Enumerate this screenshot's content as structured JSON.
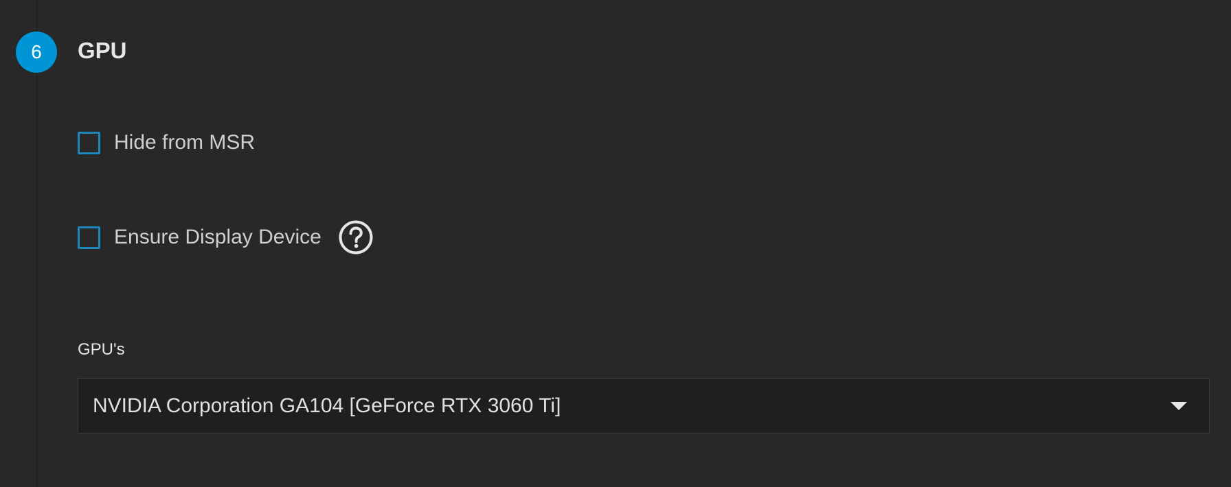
{
  "step": {
    "number": "6",
    "title": "GPU"
  },
  "options": {
    "hide_from_msr": {
      "label": "Hide from MSR",
      "checked": false
    },
    "ensure_display_device": {
      "label": "Ensure Display Device",
      "checked": false,
      "help_icon": "question-circle-icon"
    }
  },
  "gpus_field": {
    "label": "GPU's",
    "selected_value": "NVIDIA Corporation GA104 [GeForce RTX 3060 Ti]",
    "dropdown_icon": "caret-down-icon"
  },
  "colors": {
    "background": "#282828",
    "accent": "#0095d5",
    "checkbox_border": "#1a87bd",
    "select_background": "#1f1f1f"
  }
}
